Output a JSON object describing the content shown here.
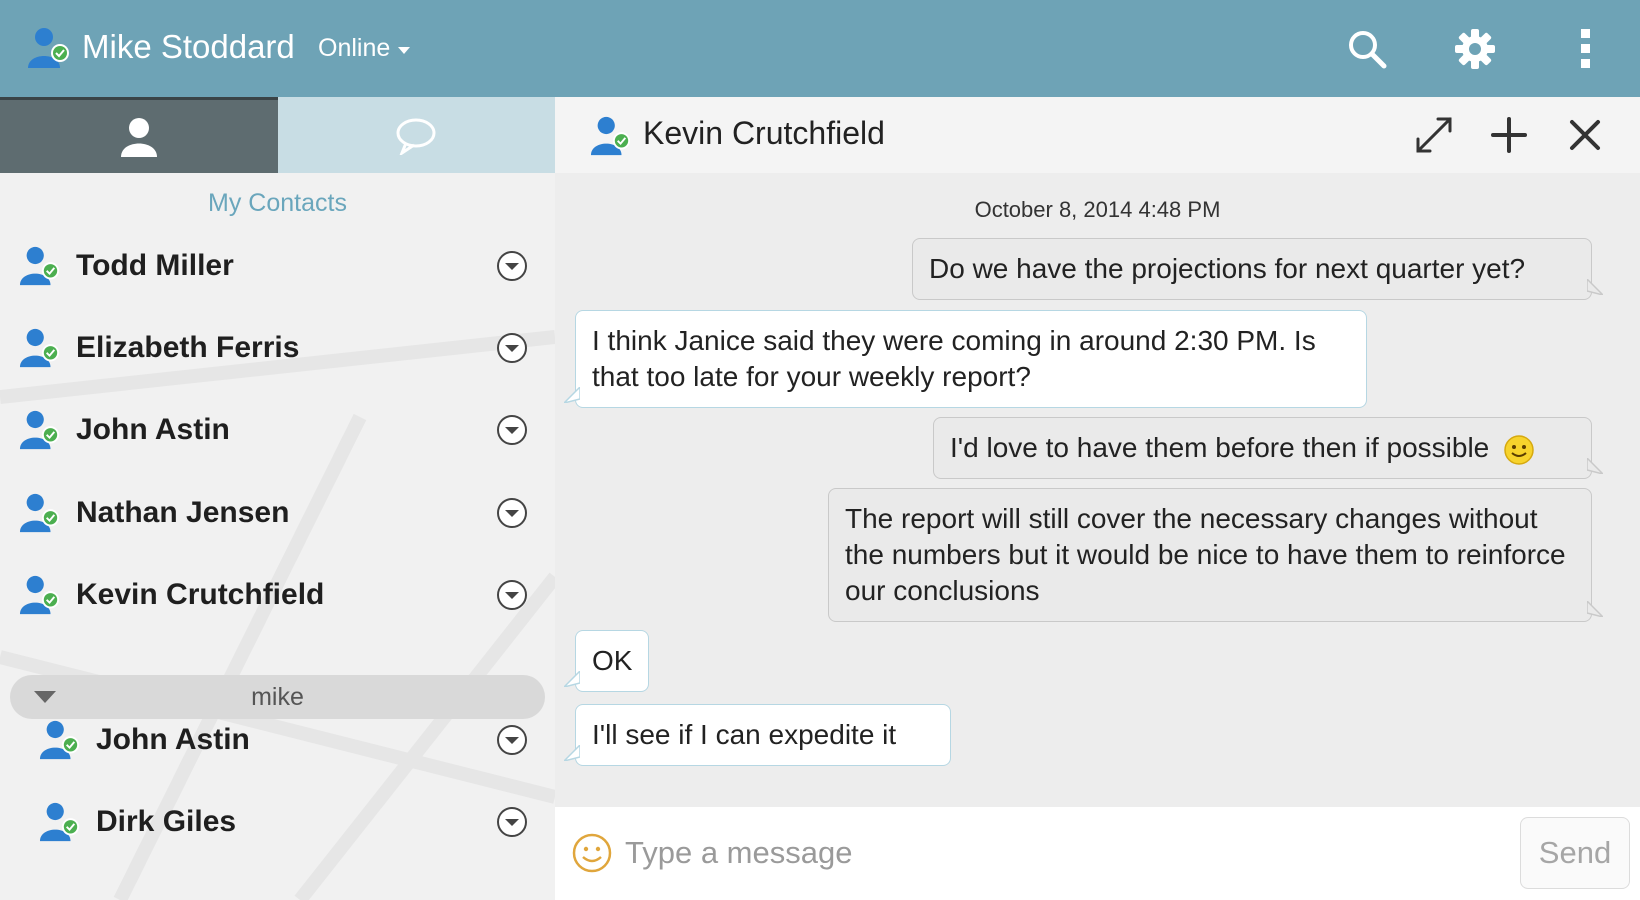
{
  "topbar": {
    "user_name": "Mike Stoddard",
    "presence": "Online",
    "icons": [
      "user-online-icon",
      "search-icon",
      "gear-icon",
      "more-vertical-icon"
    ]
  },
  "sidebar": {
    "tabs": [
      {
        "icon": "person-icon",
        "active": true
      },
      {
        "icon": "chat-bubble-icon",
        "active": false
      }
    ],
    "section_title": "My Contacts",
    "contacts": [
      {
        "name": "Todd Miller"
      },
      {
        "name": "Elizabeth Ferris"
      },
      {
        "name": "John Astin"
      },
      {
        "name": "Nathan Jensen"
      },
      {
        "name": "Kevin Crutchfield"
      }
    ],
    "group": {
      "name": "mike",
      "expanded": true,
      "contacts": [
        {
          "name": "John Astin"
        },
        {
          "name": "Dirk Giles"
        }
      ]
    }
  },
  "chat": {
    "contact_name": "Kevin Crutchfield",
    "timestamp": "October 8, 2014 4:48 PM",
    "messages": [
      {
        "direction": "out",
        "text": "Do we have the projections for next quarter yet?"
      },
      {
        "direction": "in",
        "text": "I think Janice said they were coming in around 2:30 PM. Is that too late for your weekly report?"
      },
      {
        "direction": "out",
        "text": "I'd love to have them before then if possible",
        "emoji": "smiley-emoji"
      },
      {
        "direction": "out",
        "text": "The report will still cover the necessary changes without the numbers but it would be nice to have them to reinforce our conclusions"
      },
      {
        "direction": "in",
        "text": "OK"
      },
      {
        "direction": "in",
        "text": "I'll see if I can expedite it"
      }
    ],
    "composer": {
      "placeholder": "Type a message",
      "value": "",
      "send_label": "Send"
    }
  },
  "colors": {
    "topbar": "#6ea3b6",
    "active_tab": "#5e6c70",
    "inactive_tab": "#c8dde4",
    "accent_text": "#6aa6bc",
    "incoming_border": "#b6d7e3",
    "presence_dot": "#4caf50"
  }
}
